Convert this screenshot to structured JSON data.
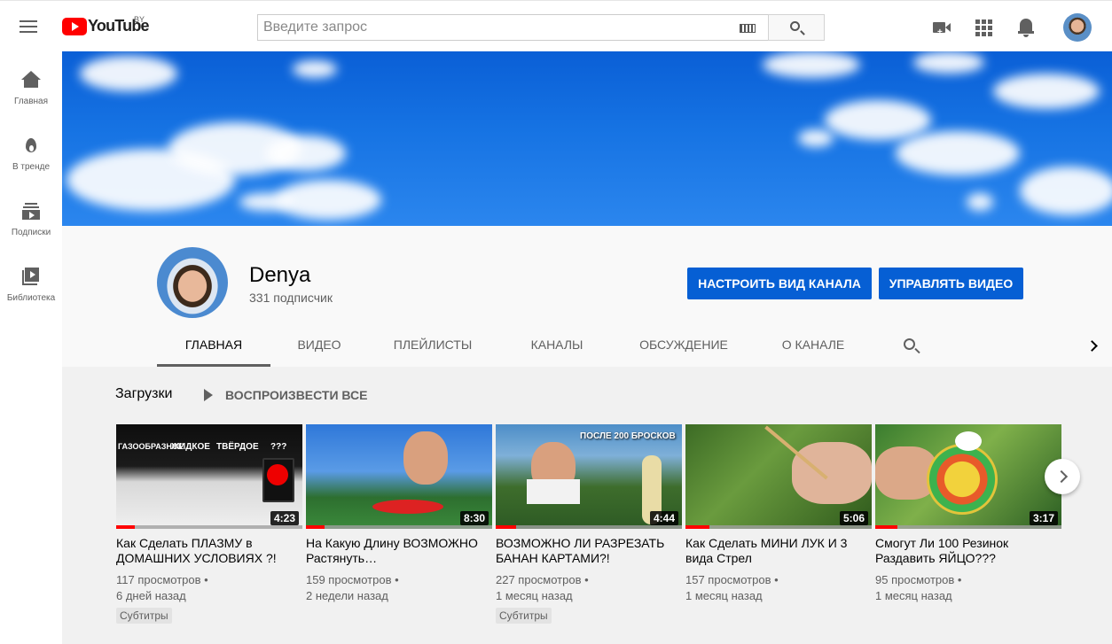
{
  "header": {
    "logo_text": "YouTube",
    "logo_region": "BY",
    "search_placeholder": "Введите запрос",
    "icons": [
      "menu-icon",
      "keyboard-icon",
      "search-icon",
      "video-camera-icon",
      "apps-icon",
      "bell-icon",
      "avatar"
    ]
  },
  "sidebar": {
    "items": [
      {
        "label": "Главная",
        "icon": "home-icon"
      },
      {
        "label": "В тренде",
        "icon": "fire-icon"
      },
      {
        "label": "Подписки",
        "icon": "subscriptions-icon"
      },
      {
        "label": "Библиотека",
        "icon": "library-icon"
      }
    ]
  },
  "channel": {
    "name": "Denya",
    "subscribers": "331 подписчик",
    "customize_label": "НАСТРОИТЬ ВИД КАНАЛА",
    "manage_label": "УПРАВЛЯТЬ ВИДЕО",
    "tabs": [
      "ГЛАВНАЯ",
      "ВИДЕО",
      "ПЛЕЙЛИСТЫ",
      "КАНАЛЫ",
      "ОБСУЖДЕНИЕ",
      "О КАНАЛЕ"
    ],
    "active_tab": "ГЛАВНАЯ"
  },
  "shelf": {
    "title": "Загрузки",
    "play_all": "ВОСПРОИЗВЕСТИ ВСЕ"
  },
  "videos": [
    {
      "title": "Как Сделать ПЛАЗМУ в ДОМАШНИХ УСЛОВИЯХ ?!",
      "views": "117 просмотров",
      "age": "6 дней назад",
      "duration": "4:23",
      "badge": "Субтитры",
      "watched": 0.1,
      "overlay": [
        "ГАЗООБРАЗНОЕ",
        "ЖИДКОЕ",
        "ТВЁРДОЕ",
        "???"
      ]
    },
    {
      "title": "На Какую Длину ВОЗМОЖНО Растянуть…",
      "views": "159 просмотров",
      "age": "2 недели назад",
      "duration": "8:30",
      "badge": "",
      "watched": 0.1
    },
    {
      "title": "ВОЗМОЖНО ЛИ РАЗРЕЗАТЬ БАНАН КАРТАМИ?!",
      "views": "227 просмотров",
      "age": "1 месяц назад",
      "duration": "4:44",
      "badge": "Субтитры",
      "watched": 0.11,
      "overlay": [
        "ПОСЛЕ 200 БРОСКОВ"
      ]
    },
    {
      "title": "Как Сделать МИНИ ЛУК И 3 вида Стрел",
      "views": "157 просмотров",
      "age": "1 месяц назад",
      "duration": "5:06",
      "badge": "",
      "watched": 0.13
    },
    {
      "title": "Смогут Ли 100 Резинок Раздавить ЯЙЦО???",
      "views": "95 просмотров",
      "age": "1 месяц назад",
      "duration": "3:17",
      "badge": "",
      "watched": 0.12
    }
  ],
  "colors": {
    "accent": "#065fd4",
    "brand": "#ff0000",
    "progress": "#ff0000"
  }
}
